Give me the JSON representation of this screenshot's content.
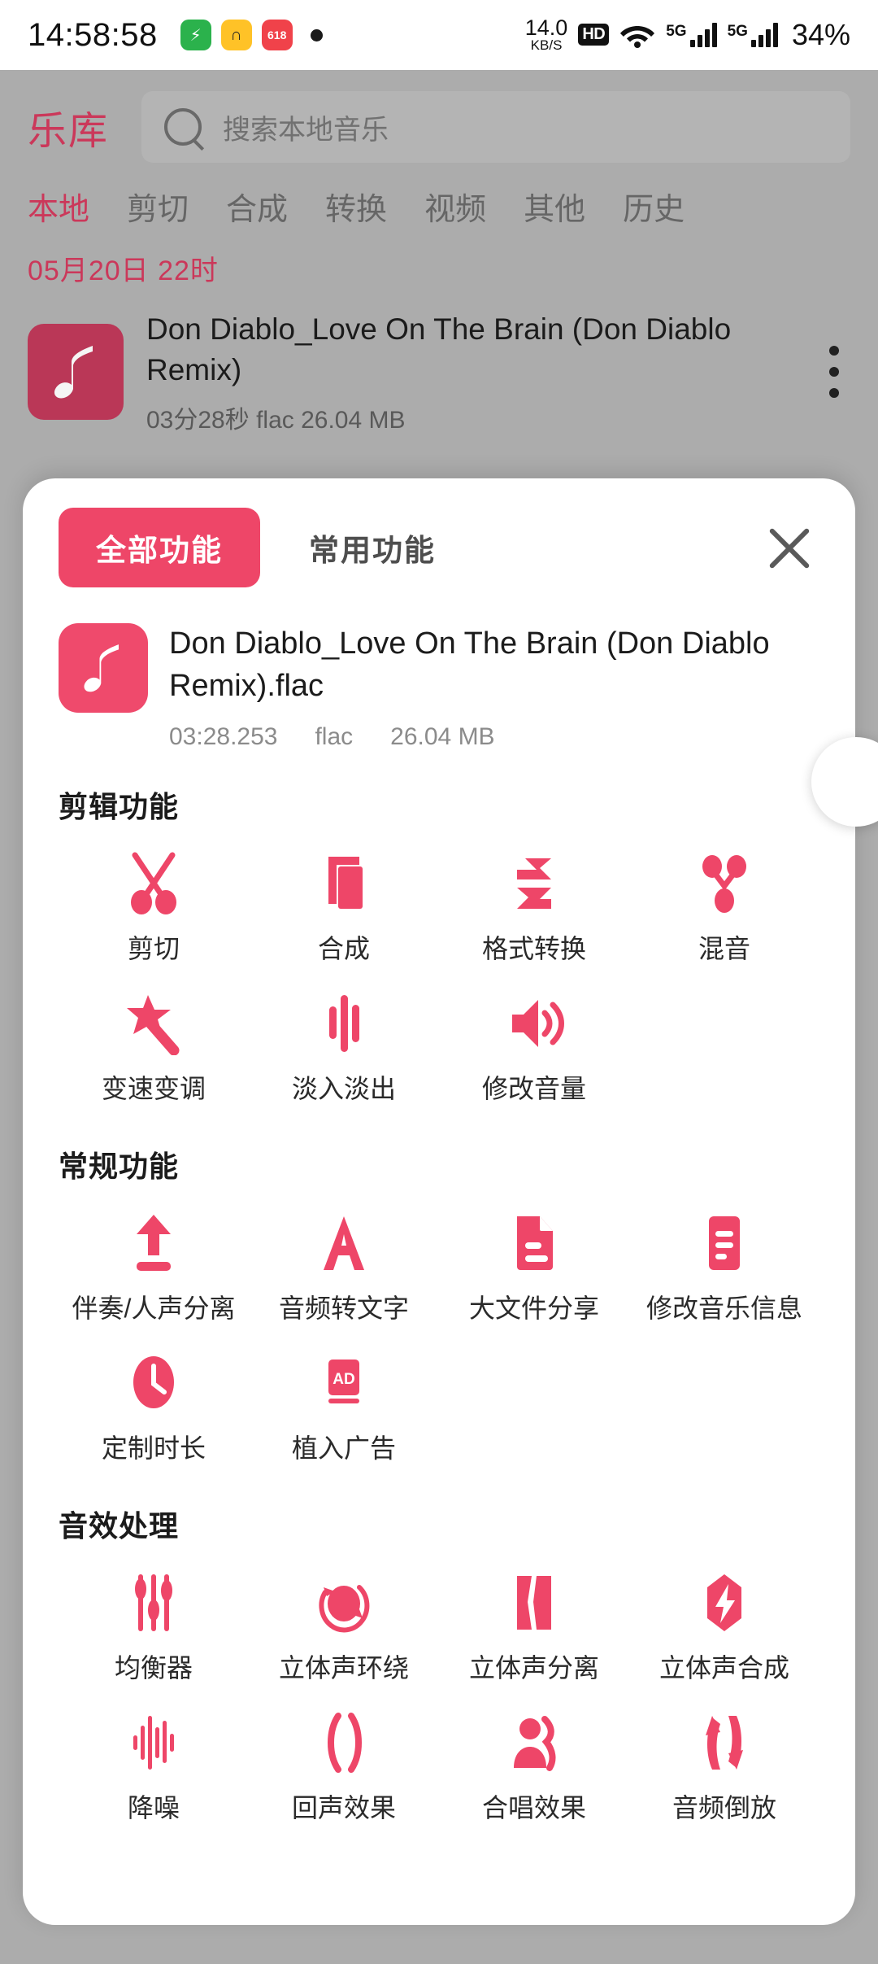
{
  "status_bar": {
    "time": "14:58:58",
    "app_icons": [
      "battery-saver-icon",
      "headphone-app-icon",
      "shopping-618-icon"
    ],
    "net_speed_value": "14.0",
    "net_speed_unit": "KB/S",
    "hd_badge": "HD",
    "wifi_sub": "5",
    "sim1_label": "5G",
    "sim2_label": "5G",
    "battery": "34%"
  },
  "app": {
    "brand": "乐库",
    "search_placeholder": "搜索本地音乐",
    "tabs": [
      {
        "label": "本地",
        "active": true
      },
      {
        "label": "剪切",
        "active": false
      },
      {
        "label": "合成",
        "active": false
      },
      {
        "label": "转换",
        "active": false
      },
      {
        "label": "视频",
        "active": false
      },
      {
        "label": "其他",
        "active": false
      },
      {
        "label": "历史",
        "active": false
      }
    ],
    "date_header": "05月20日  22时",
    "list_item": {
      "title": "Don Diablo_Love On The Brain (Don Diablo Remix)",
      "subtitle": "03分28秒   flac   26.04 MB"
    }
  },
  "sheet": {
    "tab_all": "全部功能",
    "tab_common": "常用功能",
    "close_icon": "close-icon",
    "file": {
      "name": "Don Diablo_Love On The Brain (Don Diablo Remix).flac",
      "duration": "03:28.253",
      "format": "flac",
      "size": "26.04 MB"
    },
    "sections": [
      {
        "title": "剪辑功能",
        "items": [
          {
            "label": "剪切",
            "icon": "scissors-icon"
          },
          {
            "label": "合成",
            "icon": "layers-icon"
          },
          {
            "label": "格式转换",
            "icon": "convert-arrows-icon"
          },
          {
            "label": "混音",
            "icon": "mix-nodes-icon"
          },
          {
            "label": "变速变调",
            "icon": "magic-wand-icon"
          },
          {
            "label": "淡入淡出",
            "icon": "fade-bars-icon"
          },
          {
            "label": "修改音量",
            "icon": "volume-icon"
          }
        ]
      },
      {
        "title": "常规功能",
        "items": [
          {
            "label": "伴奏/人声分离",
            "icon": "upload-arrow-icon"
          },
          {
            "label": "音频转文字",
            "icon": "letter-a-icon"
          },
          {
            "label": "大文件分享",
            "icon": "document-icon"
          },
          {
            "label": "修改音乐信息",
            "icon": "list-lines-icon"
          },
          {
            "label": "定制时长",
            "icon": "clock-icon"
          },
          {
            "label": "植入广告",
            "icon": "ad-badge-icon"
          }
        ]
      },
      {
        "title": "音效处理",
        "items": [
          {
            "label": "均衡器",
            "icon": "equalizer-icon"
          },
          {
            "label": "立体声环绕",
            "icon": "surround-icon"
          },
          {
            "label": "立体声分离",
            "icon": "split-stereo-icon"
          },
          {
            "label": "立体声合成",
            "icon": "merge-stereo-icon"
          },
          {
            "label": "降噪",
            "icon": "waveform-icon"
          },
          {
            "label": "回声效果",
            "icon": "echo-parens-icon"
          },
          {
            "label": "合唱效果",
            "icon": "chorus-people-icon"
          },
          {
            "label": "音频倒放",
            "icon": "reverse-arrows-icon"
          }
        ]
      }
    ]
  },
  "theme": {
    "accent": "#EE4668",
    "accent_dark": "#D43B5E",
    "bg": "#B3B3B3"
  }
}
